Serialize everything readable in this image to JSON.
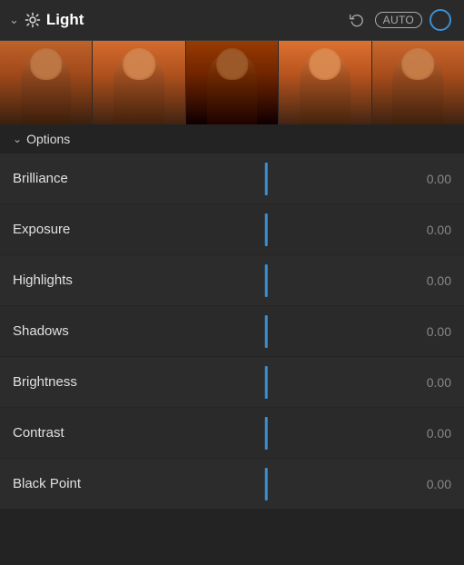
{
  "header": {
    "title": "Light",
    "chevron": "chevron-down",
    "undo_label": "↩",
    "auto_label": "AUTO"
  },
  "options": {
    "label": "Options",
    "chevron": "chevron-down"
  },
  "sliders": [
    {
      "label": "Brilliance",
      "value": "0.00"
    },
    {
      "label": "Exposure",
      "value": "0.00"
    },
    {
      "label": "Highlights",
      "value": "0.00"
    },
    {
      "label": "Shadows",
      "value": "0.00"
    },
    {
      "label": "Brightness",
      "value": "0.00"
    },
    {
      "label": "Contrast",
      "value": "0.00"
    },
    {
      "label": "Black Point",
      "value": "0.00"
    }
  ],
  "colors": {
    "accent_blue": "#3a8fd4",
    "bg_dark": "#232323",
    "text_primary": "#ffffff",
    "text_secondary": "#aaaaaa",
    "text_value": "#888888"
  }
}
